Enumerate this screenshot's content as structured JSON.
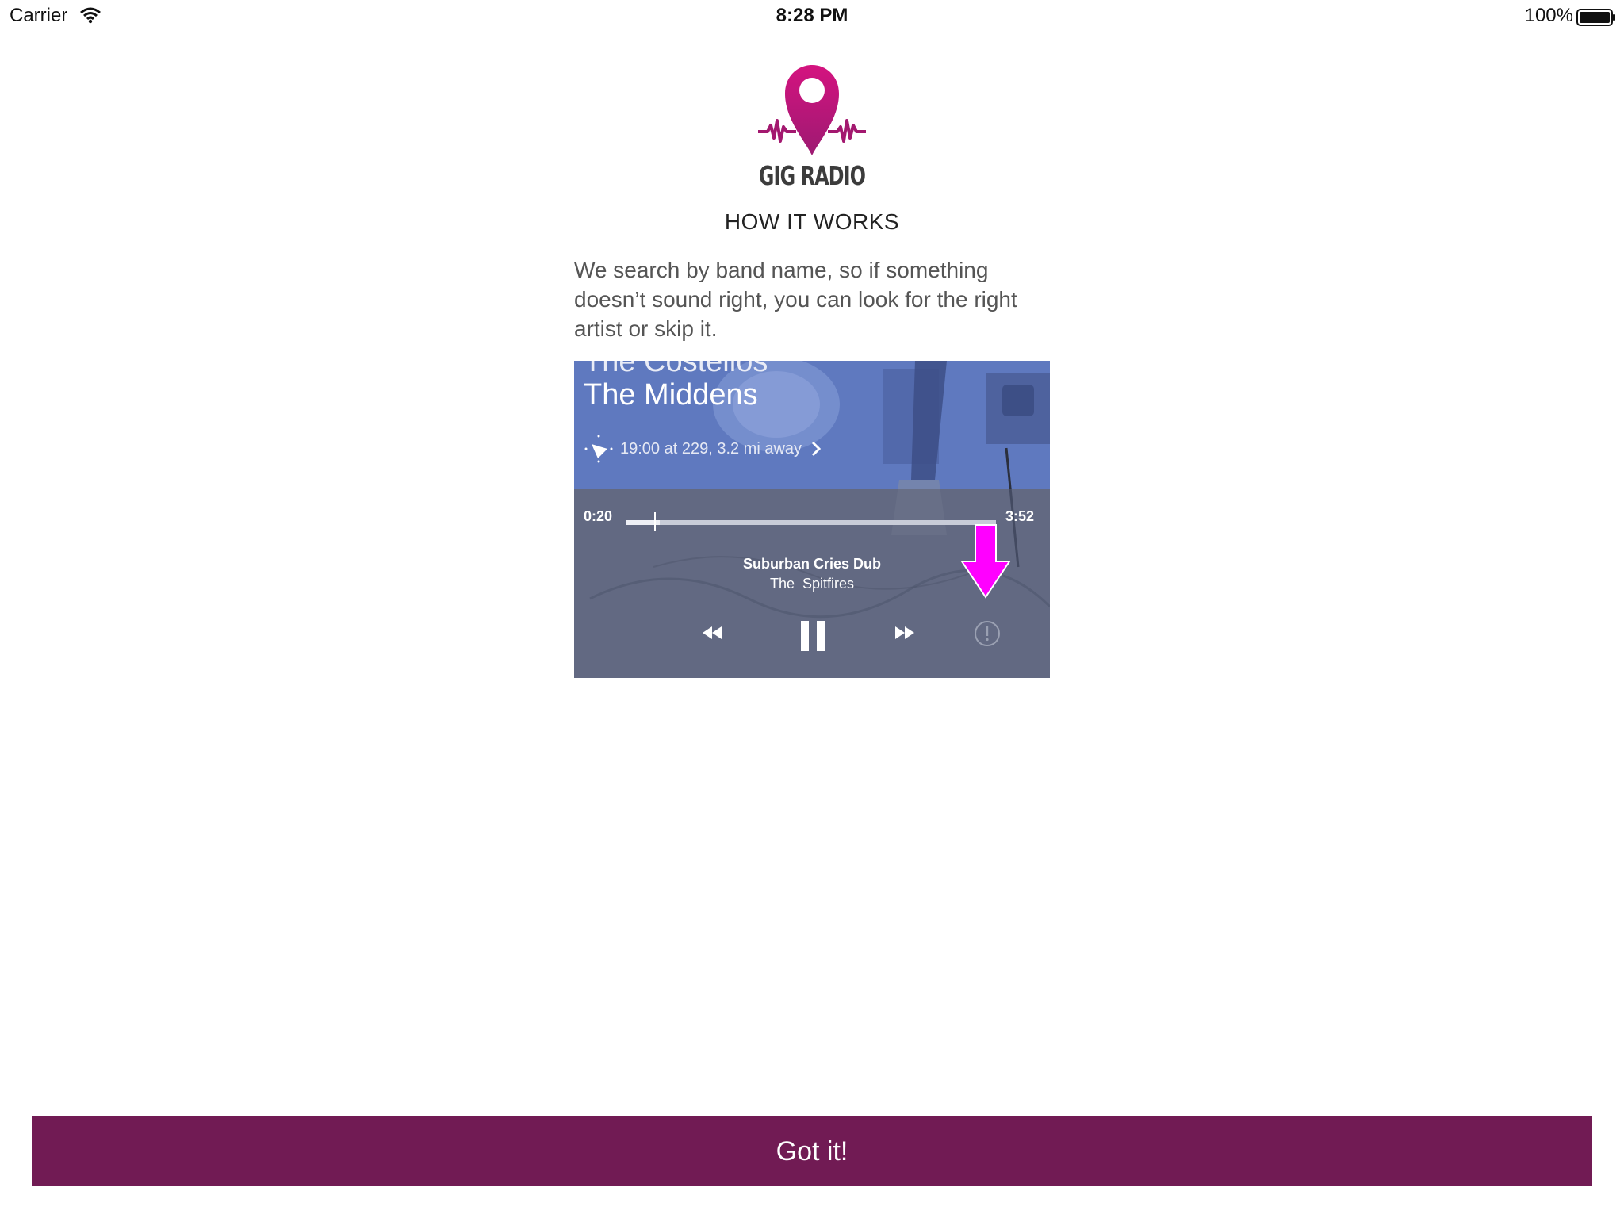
{
  "status_bar": {
    "carrier": "Carrier",
    "time": "8:28 PM",
    "battery": "100%"
  },
  "logo": {
    "text": "GIG RADIO",
    "icon": "map-pin-soundwave-icon",
    "color": "#c8157e"
  },
  "heading": "HOW IT WORKS",
  "description": "We search by band name, so if something doesn’t sound right, you can look for the right artist or skip it.",
  "tutorial_image": {
    "band_previous": "The Costellos",
    "band_name": "The Middens",
    "venue_info": "19:00 at 229, 3.2 mi away",
    "player": {
      "current_time": "0:20",
      "total_time": "3:52",
      "progress": 0.09,
      "track_title": "Suburban Cries Dub",
      "track_artist": "The  Spitfires",
      "controls": [
        "rewind-icon",
        "pause-icon",
        "fast-forward-icon",
        "report-icon"
      ]
    }
  },
  "highlight_arrow_color": "#ff00ff",
  "button": {
    "label": "Got it!",
    "color": "#711b54"
  }
}
